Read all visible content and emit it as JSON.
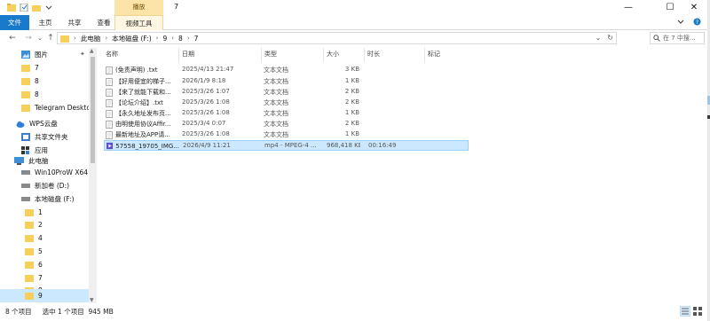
{
  "window": {
    "title": "7",
    "context_tab_top": "播放",
    "controls": {
      "minimize": "—",
      "maximize": "☐",
      "close": "✕"
    }
  },
  "ribbon": {
    "tabs": [
      "文件",
      "主页",
      "共享",
      "查看"
    ],
    "context_tab": "视频工具"
  },
  "address": {
    "crumbs": [
      "此电脑",
      "本地磁盘 (F:)",
      "9",
      "8",
      "7"
    ],
    "search_placeholder": "在 7 中搜...",
    "search_icon": "search-icon"
  },
  "nav": {
    "items": [
      {
        "label": "图片",
        "icon": "pictures-icon",
        "pinned": true
      },
      {
        "label": "7",
        "icon": "folder-icon"
      },
      {
        "label": "8",
        "icon": "folder-icon"
      },
      {
        "label": "8",
        "icon": "folder-icon"
      },
      {
        "label": "Telegram Desktop",
        "icon": "folder-icon"
      },
      {
        "label": "WPS云盘",
        "icon": "cloud-icon"
      },
      {
        "label": "共享文件夹",
        "icon": "shared-folder-icon"
      },
      {
        "label": "应用",
        "icon": "apps-icon"
      },
      {
        "label": "此电脑",
        "icon": "computer-icon"
      },
      {
        "label": "Win10ProW X64 (C",
        "icon": "drive-icon"
      },
      {
        "label": "新加卷 (D:)",
        "icon": "drive-icon"
      },
      {
        "label": "本地磁盘 (F:)",
        "icon": "drive-icon"
      },
      {
        "label": "1",
        "icon": "folder-icon"
      },
      {
        "label": "2",
        "icon": "folder-icon"
      },
      {
        "label": "4",
        "icon": "folder-icon"
      },
      {
        "label": "5",
        "icon": "folder-icon"
      },
      {
        "label": "6",
        "icon": "folder-icon"
      },
      {
        "label": "7",
        "icon": "folder-icon"
      },
      {
        "label": "8",
        "icon": "folder-icon"
      },
      {
        "label": "9",
        "icon": "folder-icon",
        "selected": true
      }
    ]
  },
  "columns": [
    "名称",
    "日期",
    "类型",
    "大小",
    "时长",
    "标记"
  ],
  "files": [
    {
      "name": "(免责声明) .txt",
      "date": "2025/4/13 21:47",
      "type": "文本文档",
      "size": "3 KB",
      "length": ""
    },
    {
      "name": "【好用便宜的梯子...",
      "date": "2026/1/9 8:18",
      "type": "文本文档",
      "size": "1 KB",
      "length": ""
    },
    {
      "name": "【来了就能下载和...",
      "date": "2025/3/26 1:07",
      "type": "文本文档",
      "size": "2 KB",
      "length": ""
    },
    {
      "name": "【论坛介绍】.txt",
      "date": "2025/3/26 1:08",
      "type": "文本文档",
      "size": "2 KB",
      "length": ""
    },
    {
      "name": "【永久地址发布页...",
      "date": "2025/3/26 1:08",
      "type": "文本文档",
      "size": "1 KB",
      "length": ""
    },
    {
      "name": "由明使用协议Affir...",
      "date": "2025/3/4 0:07",
      "type": "文本文档",
      "size": "2 KB",
      "length": ""
    },
    {
      "name": "最新地址及APP请...",
      "date": "2025/3/26 1:08",
      "type": "文本文档",
      "size": "1 KB",
      "length": ""
    },
    {
      "name": "57558_19705_IMG...",
      "date": "2026/4/9 11:21",
      "type": "mp4 - MPEG-4 ...",
      "size": "968,418 KB",
      "length": "00:16:49",
      "selected": true,
      "video": true
    }
  ],
  "status": {
    "count": "8 个项目",
    "selection": "选中 1 个项目",
    "size": "945 MB"
  },
  "colors": {
    "file_tab": "#1979ca",
    "context_tab": "#fce4a8",
    "selection": "#cce8ff",
    "folder": "#f7cf5b"
  }
}
